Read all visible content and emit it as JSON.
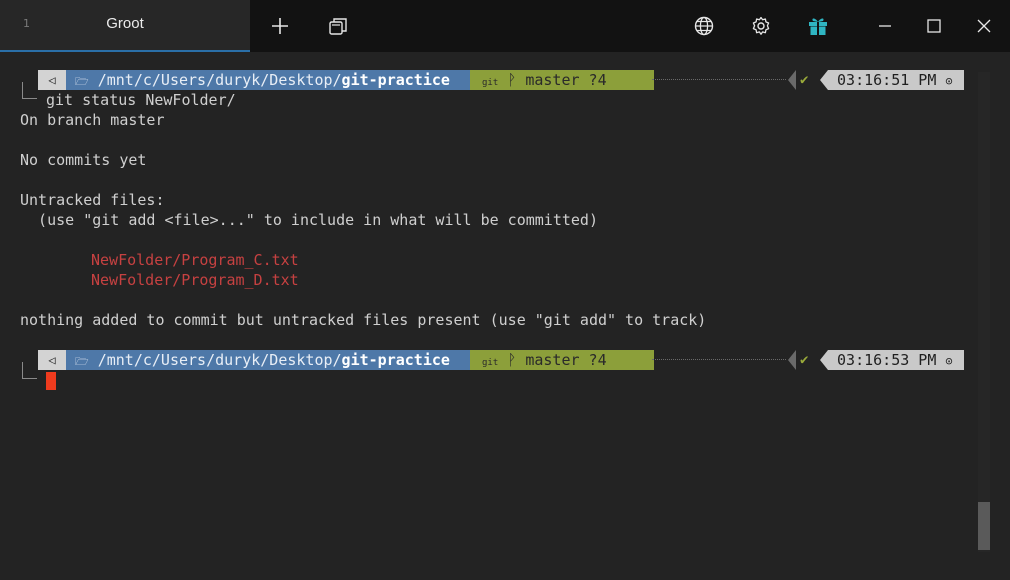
{
  "window": {
    "tab_number": "1",
    "tab_title": "Groot",
    "icons": [
      "plus-icon",
      "duplicate-window-icon",
      "globe-icon",
      "gear-icon",
      "gift-icon",
      "minimize-icon",
      "maximize-icon",
      "close-icon"
    ]
  },
  "colors": {
    "accent": "#2a6fa8",
    "path_segment": "#4e78a8",
    "git_segment": "#8c9f3a",
    "error_text": "#c64141",
    "cursor": "#ef3b1e"
  },
  "prompts": [
    {
      "os_glyph": "◁",
      "folder_glyph": "🗁",
      "path_prefix": "/mnt/c/Users/duryk/Desktop/",
      "path_current": "git-practice",
      "git_label": "git",
      "branch_glyph": "ᚹ",
      "branch": "master ?4",
      "status_glyph": "✔",
      "time": "03:16:51 PM",
      "clock_glyph": "⊙"
    },
    {
      "os_glyph": "◁",
      "folder_glyph": "🗁",
      "path_prefix": "/mnt/c/Users/duryk/Desktop/",
      "path_current": "git-practice",
      "git_label": "git",
      "branch_glyph": "ᚹ",
      "branch": "master ?4",
      "status_glyph": "✔",
      "time": "03:16:53 PM",
      "clock_glyph": "⊙"
    }
  ],
  "output": {
    "command": "git status NewFolder/",
    "line1": "On branch master",
    "line2": "No commits yet",
    "line3": "Untracked files:",
    "line4": "  (use \"git add <file>...\" to include in what will be committed)",
    "file1": "NewFolder/Program_C.txt",
    "file2": "NewFolder/Program_D.txt",
    "line5": "nothing added to commit but untracked files present (use \"git add\" to track)"
  }
}
